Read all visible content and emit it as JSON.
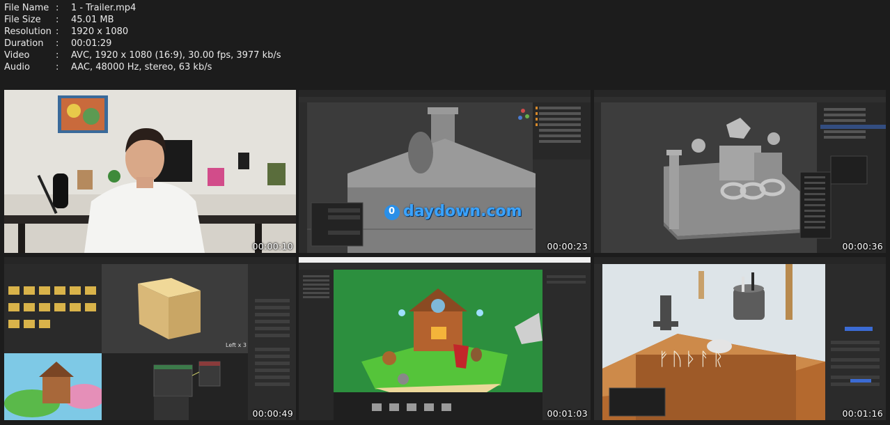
{
  "file_info": [
    {
      "key": "File Name",
      "value": "1 - Trailer.mp4"
    },
    {
      "key": "File Size",
      "value": "45.01 MB"
    },
    {
      "key": "Resolution",
      "value": "1920 x 1080"
    },
    {
      "key": "Duration",
      "value": "00:01:29"
    },
    {
      "key": "Video",
      "value": "AVC, 1920 x 1080 (16:9), 30.00 fps, 3977 kb/s"
    },
    {
      "key": "Audio",
      "value": "AAC, 48000 Hz, stereo, 63 kb/s"
    }
  ],
  "separator": ":",
  "thumbnails": [
    {
      "timestamp": "00:00:10"
    },
    {
      "timestamp": "00:00:23"
    },
    {
      "timestamp": "00:00:36"
    },
    {
      "timestamp": "00:00:49"
    },
    {
      "timestamp": "00:01:03"
    },
    {
      "timestamp": "00:01:16"
    }
  ],
  "watermark": "daydown.com",
  "watermark_badge": "0",
  "viewport_label_left": "Left x 3",
  "runes": "ᚠᚢᚦᚨᚱ"
}
